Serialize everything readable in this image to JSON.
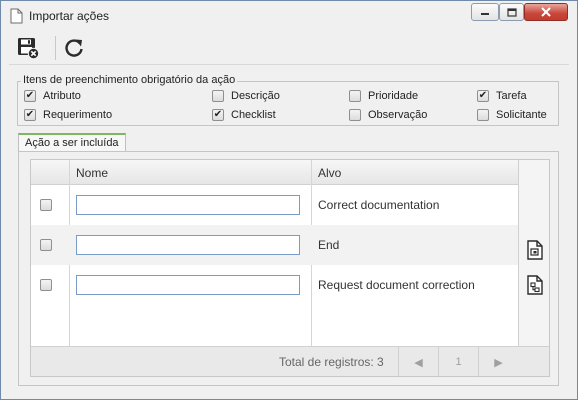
{
  "window": {
    "title": "Importar ações"
  },
  "toolbar": {
    "save_close_icon": "save-close-icon",
    "refresh_icon": "refresh-icon"
  },
  "required_fields": {
    "legend": "Itens de preenchimento obrigatório da ação",
    "items": [
      {
        "label": "Atributo",
        "checked": true
      },
      {
        "label": "Descrição",
        "checked": false
      },
      {
        "label": "Prioridade",
        "checked": false
      },
      {
        "label": "Tarefa",
        "checked": true
      },
      {
        "label": "Requerimento",
        "checked": true
      },
      {
        "label": "Checklist",
        "checked": true
      },
      {
        "label": "Observação",
        "checked": false
      },
      {
        "label": "Solicitante",
        "checked": false
      }
    ]
  },
  "tab": {
    "label": "Ação a ser incluída"
  },
  "grid": {
    "columns": [
      "Nome",
      "Alvo"
    ],
    "rows": [
      {
        "nome": "",
        "alvo": "Correct documentation"
      },
      {
        "nome": "",
        "alvo": "End"
      },
      {
        "nome": "",
        "alvo": "Request document correction"
      }
    ],
    "footer": {
      "total": "Total de registros: 3",
      "page": "1"
    }
  },
  "colors": {
    "tab_accent": "#7fb661",
    "input_border": "#7a9cc9",
    "close_button": "#c7463a"
  }
}
